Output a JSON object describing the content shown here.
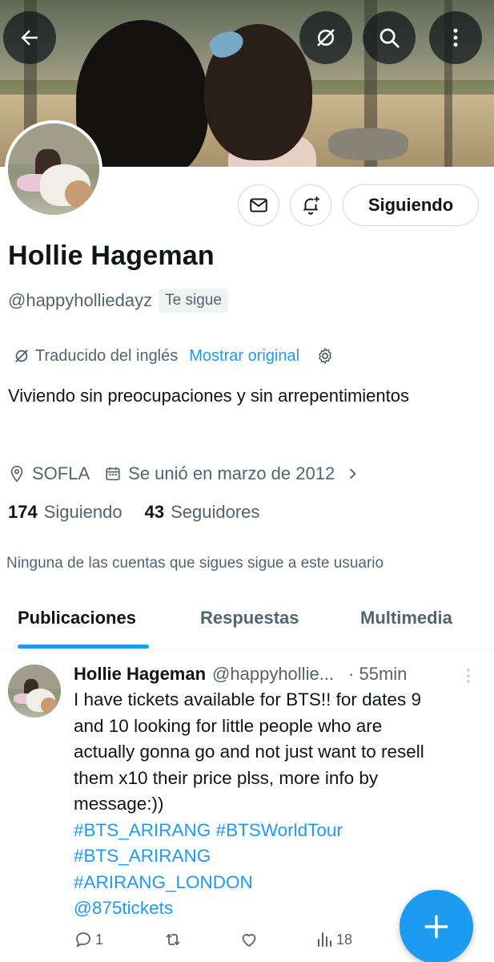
{
  "profile": {
    "name": "Hollie Hageman",
    "handle": "@happyholliedayz",
    "follows_you_badge": "Te sigue",
    "follow_button": "Siguiendo",
    "translated_label": "Traducido del inglés",
    "show_original": "Mostrar original",
    "bio": "Viviendo sin preocupaciones y sin arrepentimientos",
    "location": "SOFLA",
    "joined": "Se unió en marzo de 2012",
    "following_count": "174",
    "following_label": "Siguiendo",
    "followers_count": "43",
    "followers_label": "Seguidores",
    "mutuals_text": "Ninguna de las cuentas que sigues sigue a este usuario"
  },
  "tabs": [
    {
      "label": "Publicaciones",
      "active": true
    },
    {
      "label": "Respuestas",
      "active": false
    },
    {
      "label": "Multimedia",
      "active": false
    }
  ],
  "post": {
    "author": "Hollie Hageman",
    "handle": "@happyhollie...",
    "time": "· 55min",
    "lines": [
      "I have tickets available for BTS!! for dates  9",
      "and 10 looking for little people who are",
      "actually gonna go and not just want to resell",
      "them x10 their price plss, more info by",
      "message:))"
    ],
    "hashtag_line1": "#BTS_ARIRANG #BTSWorldTour",
    "hashtag_line2": "#BTS_ARIRANG",
    "hashtag_line3": "#ARIRANG_LONDON",
    "mention": "@875tickets",
    "replies": "1",
    "reposts": "",
    "likes": "",
    "views": "18"
  },
  "icons": {
    "back": "back-arrow-icon",
    "translate": "translate-icon",
    "search": "search-icon",
    "more": "more-vertical-icon",
    "message": "envelope-icon",
    "notify": "bell-plus-icon",
    "compose": "plus-icon"
  },
  "colors": {
    "accent": "#1d9bf0",
    "secondary_text": "#536471",
    "primary_text": "#0f1419"
  }
}
